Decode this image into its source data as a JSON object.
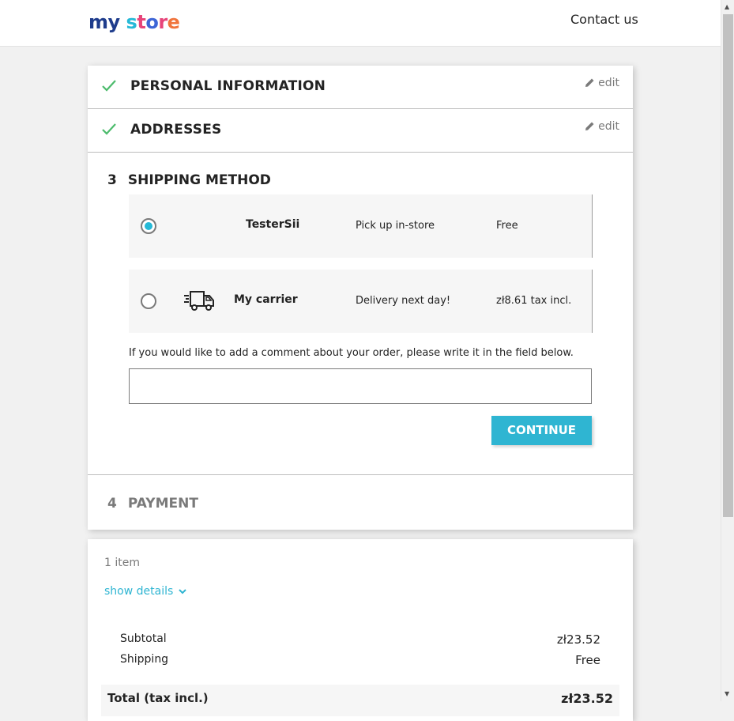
{
  "header": {
    "logo_letters": [
      {
        "ch": "m",
        "color": "#1e3c8c"
      },
      {
        "ch": "y",
        "color": "#1e3c8c"
      },
      {
        "ch": " ",
        "color": "#000000"
      },
      {
        "ch": "s",
        "color": "#25b9d7"
      },
      {
        "ch": "t",
        "color": "#e7447a"
      },
      {
        "ch": "o",
        "color": "#3d65d6"
      },
      {
        "ch": "r",
        "color": "#e7447a"
      },
      {
        "ch": "e",
        "color": "#f0743c"
      }
    ],
    "contact_label": "Contact us"
  },
  "steps": {
    "personal": {
      "title": "PERSONAL INFORMATION",
      "edit_label": "edit"
    },
    "addresses": {
      "title": "ADDRESSES",
      "edit_label": "edit"
    },
    "shipping": {
      "number": "3",
      "title": "SHIPPING METHOD",
      "carriers": [
        {
          "name": "TesterSii",
          "delay": "Pick up in-store",
          "price": "Free",
          "selected": true
        },
        {
          "name": "My carrier",
          "delay": "Delivery next day!",
          "price": "zł8.61 tax incl.",
          "selected": false,
          "icon": "truck-icon"
        }
      ],
      "comment_label": "If you would like to add a comment about your order, please write it in the field below.",
      "comment_value": "",
      "continue_label": "CONTINUE"
    },
    "payment": {
      "number": "4",
      "title": "PAYMENT"
    }
  },
  "summary": {
    "items_count": "1 item",
    "show_details_label": "show details",
    "subtotal_label": "Subtotal",
    "subtotal_value": "zł23.52",
    "shipping_label": "Shipping",
    "shipping_value": "Free",
    "total_label": "Total (tax incl.)",
    "total_value": "zł23.52"
  },
  "colors": {
    "accent": "#2fb5d2",
    "check": "#4cbb6c",
    "muted": "#7a7a7a"
  }
}
